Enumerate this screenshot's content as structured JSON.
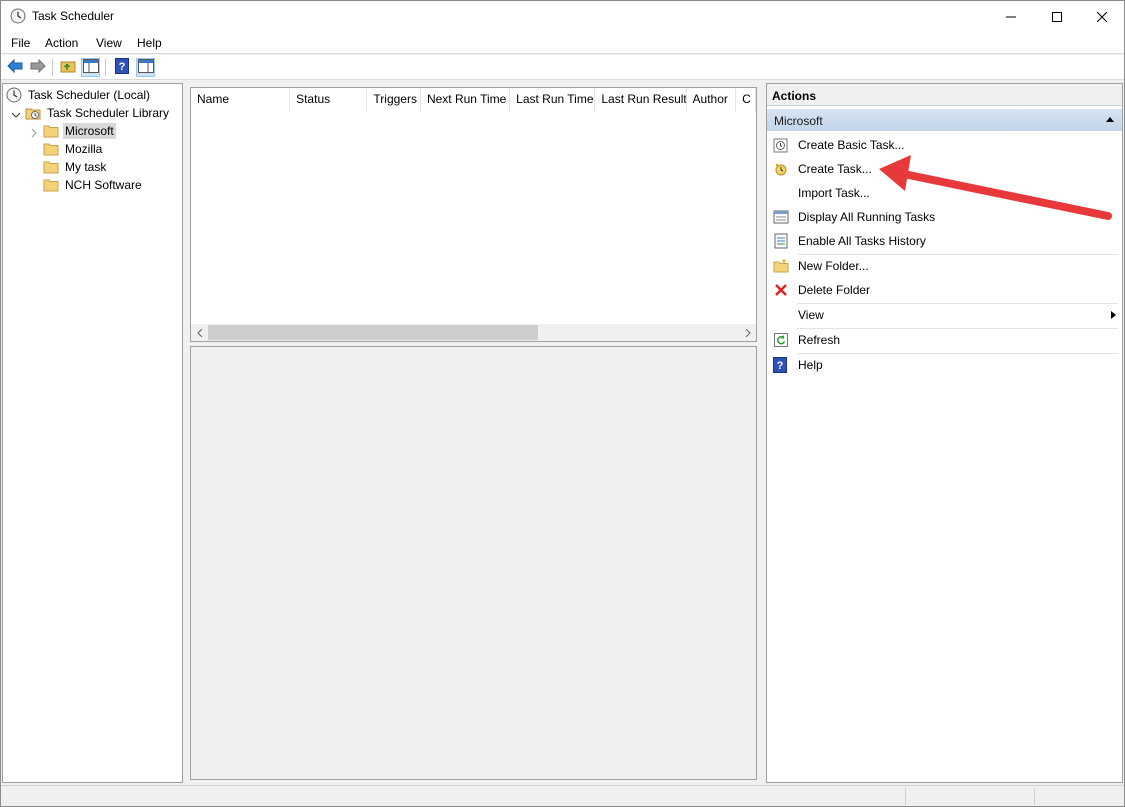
{
  "window": {
    "title": "Task Scheduler",
    "controls": [
      "minimize-icon",
      "maximize-icon",
      "close-icon"
    ]
  },
  "menu": {
    "file": "File",
    "action": "Action",
    "view": "View",
    "help": "Help"
  },
  "toolbar": {
    "icons": [
      "back-arrow-icon",
      "forward-arrow-icon",
      "up-folder-icon",
      "show-hide-console-tree-icon",
      "help-icon",
      "show-hide-action-pane-icon"
    ]
  },
  "tree": {
    "root": "Task Scheduler (Local)",
    "library": "Task Scheduler Library",
    "folders": [
      "Microsoft",
      "Mozilla",
      "My task",
      "NCH Software"
    ],
    "selected": "Microsoft"
  },
  "list": {
    "columns": [
      "Name",
      "Status",
      "Triggers",
      "Next Run Time",
      "Last Run Time",
      "Last Run Result",
      "Author",
      "C"
    ]
  },
  "actions": {
    "header": "Actions",
    "group": "Microsoft",
    "items": [
      {
        "label": "Create Basic Task...",
        "icon": "create-basic-task-icon"
      },
      {
        "label": "Create Task...",
        "icon": "create-task-icon"
      },
      {
        "label": "Import Task...",
        "icon": ""
      },
      {
        "label": "Display All Running Tasks",
        "icon": "running-tasks-icon"
      },
      {
        "label": "Enable All Tasks History",
        "icon": "tasks-history-icon"
      },
      {
        "label": "New Folder...",
        "icon": "new-folder-icon"
      },
      {
        "label": "Delete Folder",
        "icon": "delete-icon"
      },
      {
        "label": "View",
        "icon": ""
      },
      {
        "label": "Refresh",
        "icon": "refresh-icon"
      },
      {
        "label": "Help",
        "icon": "help-icon"
      }
    ]
  },
  "colors": {
    "selection": "#d9d9d9",
    "group_header": "#c8d9ec",
    "annotation_arrow": "#e8393a"
  }
}
